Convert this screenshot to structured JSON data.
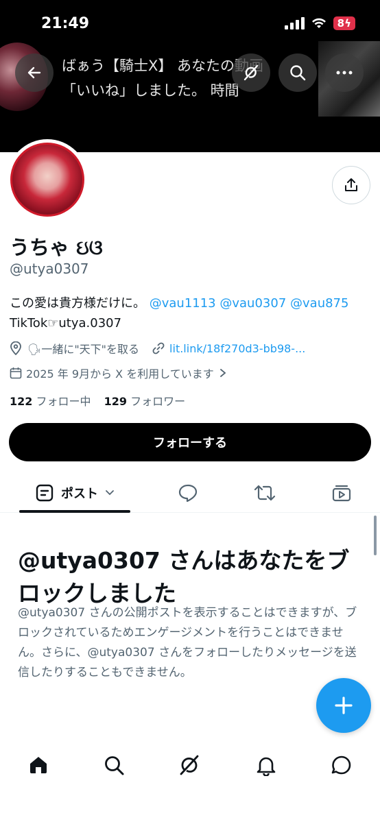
{
  "status_bar": {
    "time": "21:49",
    "battery": "8"
  },
  "header": {
    "banner_line1": "ばぁう【騎士X】 あなたの動画",
    "banner_line2": "「いいね」しました。 時間"
  },
  "profile": {
    "display_name": "うちゃ ઇଓ",
    "handle": "@utya0307",
    "bio_line1_text": "この愛は貴方様だけに。",
    "bio_mentions": [
      "@vau1113",
      "@vau0307",
      "@vau875"
    ],
    "bio_line2": "TikTok☞utya.0307",
    "location": "🗣一緒に\"天下\"を取る",
    "link": "lit.link/18f270d3-bb98-...",
    "joined": "2025 年 9月から X を利用しています",
    "following_count": "122",
    "following_label": "フォロー中",
    "followers_count": "129",
    "followers_label": "フォロワー",
    "follow_button": "フォローする"
  },
  "tabs": {
    "posts_label": "ポスト"
  },
  "blocked": {
    "title": "@utya0307 さんはあなたをブロックしました",
    "body": "@utya0307 さんの公開ポストを表示することはできますが、ブロックされているためエンゲージメントを行うことはできません。さらに、@utya0307 さんをフォローしたりメッセージを送信したりすることもできません。"
  },
  "colors": {
    "accent": "#1d9bf0",
    "text": "#0f1419",
    "secondary": "#536471",
    "battery": "#e0304a"
  },
  "icons": {
    "back": "arrow-left-icon",
    "grok": "grok-icon",
    "search": "search-icon",
    "more": "more-icon",
    "share": "share-icon",
    "location": "location-pin-icon",
    "link": "link-icon",
    "calendar": "calendar-icon",
    "posts": "posts-icon",
    "replies": "reply-icon",
    "reposts": "repost-icon",
    "media": "media-icon",
    "compose": "plus-icon",
    "home": "home-icon",
    "notifications": "bell-icon",
    "messages": "messages-icon"
  }
}
